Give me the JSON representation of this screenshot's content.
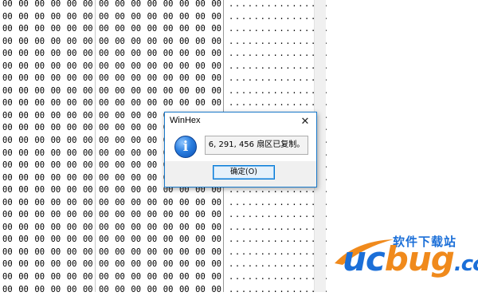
{
  "hex_view": {
    "cell_value": "00",
    "ascii_value": "................",
    "row_count": 24
  },
  "dialog": {
    "title": "WinHex",
    "close_symbol": "✕",
    "icon_glyph": "i",
    "message": "6, 291, 456 扇区已复制。",
    "ok_label": "确定(O)"
  },
  "watermark": {
    "tagline": "软件下载站",
    "logo_part1": "uc",
    "logo_part2": "bug",
    "logo_part3": ".cc",
    "colors": {
      "blue": "#1b6fd8",
      "orange": "#f08a1c"
    }
  }
}
